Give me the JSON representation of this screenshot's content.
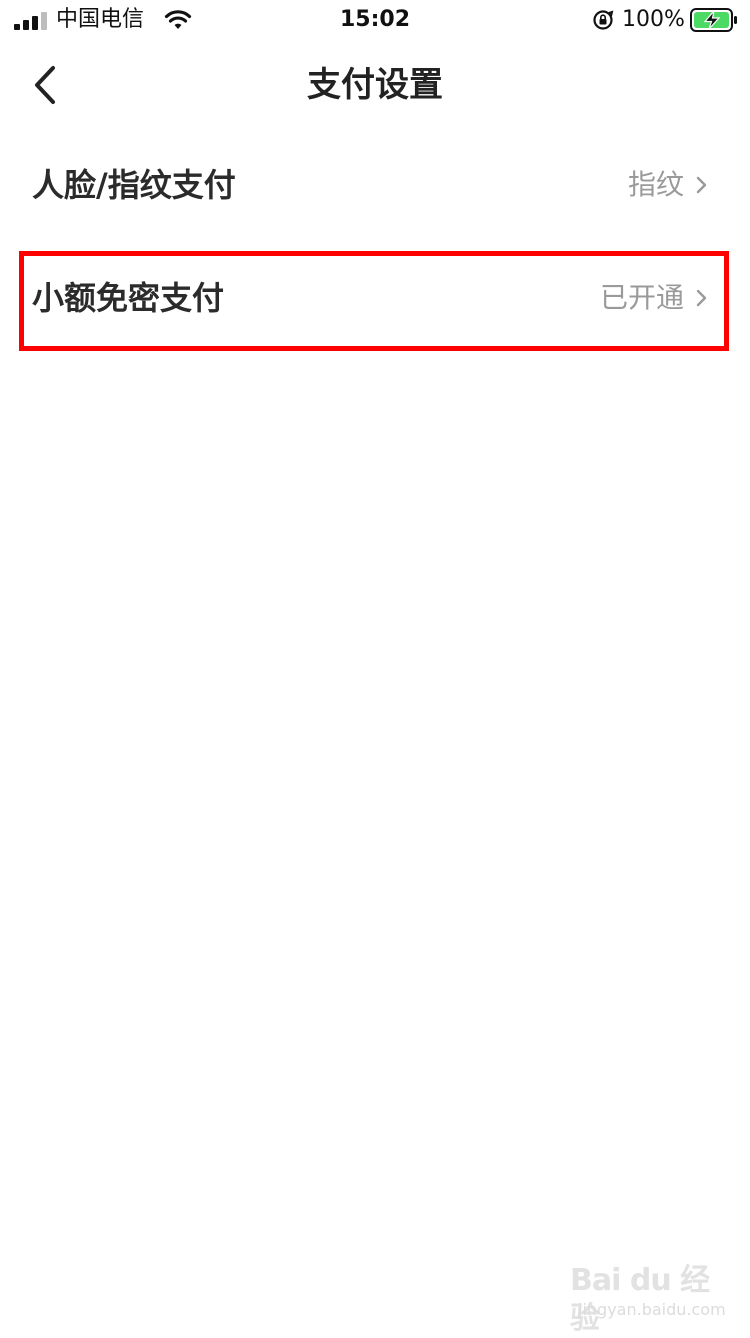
{
  "status_bar": {
    "carrier": "中国电信",
    "time": "15:02",
    "battery_percent": "100%",
    "icons": [
      "signal-icon",
      "wifi-icon",
      "rotation-lock-icon",
      "battery-charging-icon"
    ]
  },
  "nav": {
    "title": "支付设置",
    "back_icon": "chevron-left-icon"
  },
  "settings": {
    "items": [
      {
        "label": "人脸/指纹支付",
        "value": "指纹"
      },
      {
        "label": "小额免密支付",
        "value": "已开通"
      }
    ]
  },
  "watermark": {
    "main": "Bai du 经验",
    "sub": "jingyan.baidu.com"
  },
  "colors": {
    "highlight": "#ff0000",
    "battery": "#4cd964",
    "secondary_text": "#9a9a9a"
  }
}
